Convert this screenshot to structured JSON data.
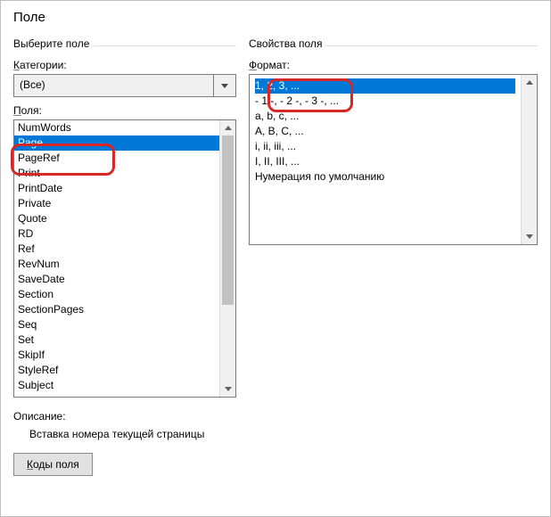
{
  "title": "Поле",
  "left": {
    "groupLabel": "Выберите поле",
    "categoriesLabel": "Категории:",
    "categoriesUnderlineChar": "К",
    "categoryValue": "(Все)",
    "fieldsLabel": "Поля:",
    "fieldsUnderlineChar": "П",
    "items": [
      "NumWords",
      "Page",
      "PageRef",
      "Print",
      "PrintDate",
      "Private",
      "Quote",
      "RD",
      "Ref",
      "RevNum",
      "SaveDate",
      "Section",
      "SectionPages",
      "Seq",
      "Set",
      "SkipIf",
      "StyleRef",
      "Subject"
    ],
    "selectedIndex": 1
  },
  "right": {
    "groupLabel": "Свойства поля",
    "formatLabel": "Формат:",
    "formatUnderlineChar": "Ф",
    "formats": [
      "1, 2, 3, ...",
      "- 1 -, - 2 -, - 3 -, ...",
      "a, b, c, ...",
      "A, B, C, ...",
      "i, ii, iii, ...",
      "I, II, III, ...",
      "Нумерация по умолчанию"
    ],
    "selectedIndex": 0
  },
  "description": {
    "label": "Описание:",
    "text": "Вставка номера текущей страницы"
  },
  "buttons": {
    "fieldCodes": "Коды поля",
    "fieldCodesUnderlineChar": "К"
  }
}
